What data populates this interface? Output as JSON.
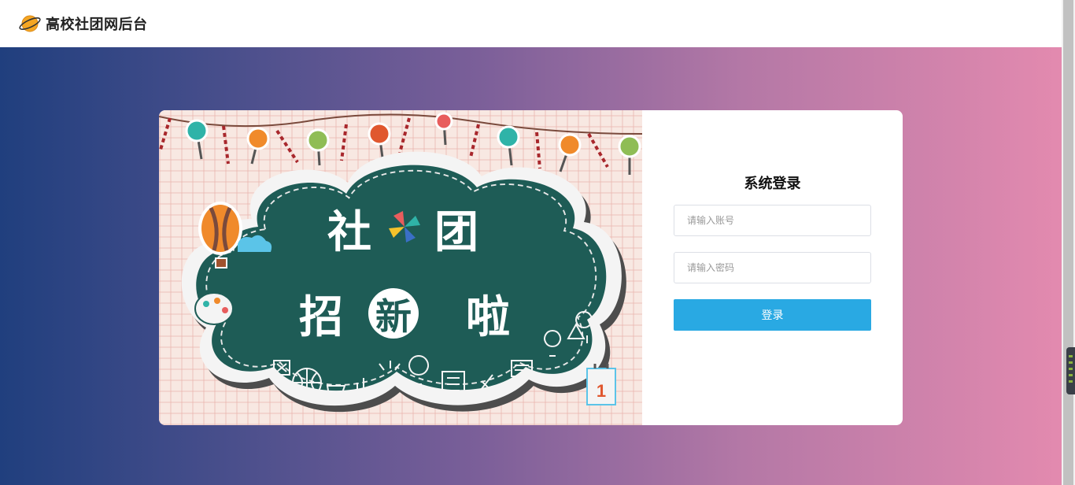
{
  "header": {
    "logo_icon": "planet-icon",
    "title": "高校社团网后台"
  },
  "banner": {
    "text_she": "社",
    "text_tuan": "团",
    "text_zhao": "招",
    "text_xin": "新",
    "text_la": "啦"
  },
  "login": {
    "title": "系统登录",
    "account_placeholder": "请输入账号",
    "account_value": "",
    "password_placeholder": "请输入密码",
    "password_value": "",
    "submit_label": "登录"
  },
  "colors": {
    "gradient_start": "#203f7e",
    "gradient_end": "#e38aaf",
    "button": "#29a9e3",
    "chalkboard": "#1e5c56"
  }
}
